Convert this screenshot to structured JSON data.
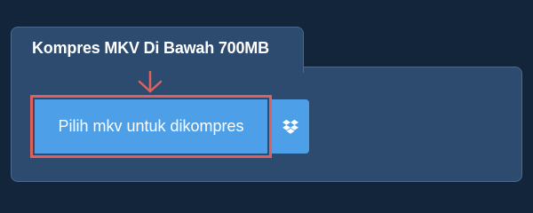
{
  "panel": {
    "title": "Kompres MKV Di Bawah 700MB"
  },
  "upload": {
    "choose_label": "Pilih mkv untuk dikompres",
    "dropbox_icon": "dropbox-icon",
    "arrow_icon": "arrow-down-icon"
  },
  "colors": {
    "background": "#13253a",
    "panel": "#2c4b6e",
    "button": "#4d9fe8",
    "highlight": "#e0605e"
  }
}
